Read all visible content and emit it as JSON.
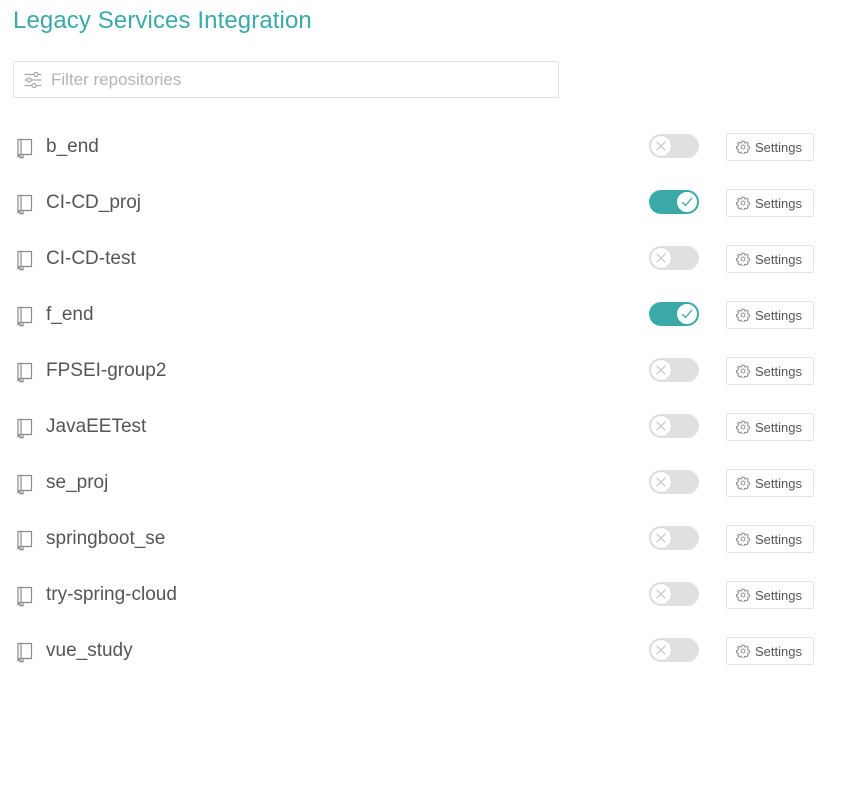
{
  "page": {
    "title": "Legacy Services Integration"
  },
  "filter": {
    "placeholder": "Filter repositories",
    "value": "",
    "icon": "filter-sliders-icon"
  },
  "colors": {
    "accent": "#3aa9a8",
    "toggle_off": "#e0e0e0",
    "text": "#555555"
  },
  "repositories": [
    {
      "name": "b_end",
      "enabled": false,
      "settings_label": "Settings"
    },
    {
      "name": "CI-CD_proj",
      "enabled": true,
      "settings_label": "Settings"
    },
    {
      "name": "CI-CD-test",
      "enabled": false,
      "settings_label": "Settings"
    },
    {
      "name": "f_end",
      "enabled": true,
      "settings_label": "Settings"
    },
    {
      "name": "FPSEI-group2",
      "enabled": false,
      "settings_label": "Settings"
    },
    {
      "name": "JavaEETest",
      "enabled": false,
      "settings_label": "Settings"
    },
    {
      "name": "se_proj",
      "enabled": false,
      "settings_label": "Settings"
    },
    {
      "name": "springboot_se",
      "enabled": false,
      "settings_label": "Settings"
    },
    {
      "name": "try-spring-cloud",
      "enabled": false,
      "settings_label": "Settings"
    },
    {
      "name": "vue_study",
      "enabled": false,
      "settings_label": "Settings"
    }
  ]
}
